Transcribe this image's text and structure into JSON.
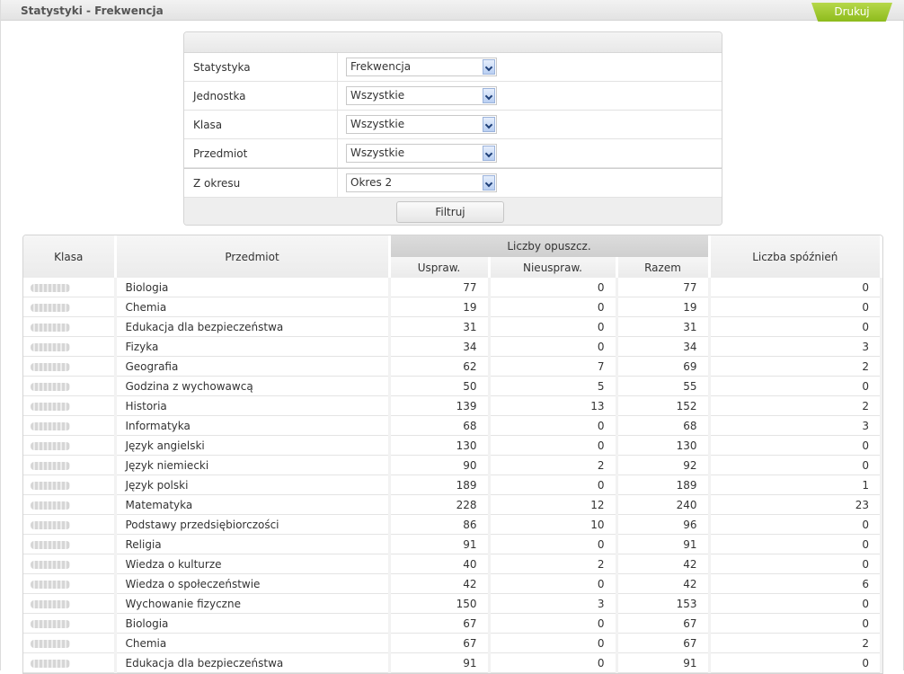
{
  "header": {
    "title": "Statystyki - Frekwencja",
    "print_label": "Drukuj"
  },
  "filter": {
    "rows": [
      {
        "label": "Statystyka",
        "value": "Frekwencja"
      },
      {
        "label": "Jednostka",
        "value": "Wszystkie"
      },
      {
        "label": "Klasa",
        "value": "Wszystkie"
      },
      {
        "label": "Przedmiot",
        "value": "Wszystkie"
      }
    ],
    "period": {
      "label": "Z okresu",
      "value": "Okres 2"
    },
    "submit_label": "Filtruj"
  },
  "table": {
    "headers": {
      "klasa": "Klasa",
      "przedmiot": "Przedmiot",
      "group": "Liczby opuszcz.",
      "uspraw": "Uspraw.",
      "nieuspraw": "Nieuspraw.",
      "razem": "Razem",
      "spoznienia": "Liczba spóźnień"
    },
    "rows": [
      {
        "przedmiot": "Biologia",
        "uspraw": "77",
        "nieuspraw": "0",
        "razem": "77",
        "spoznienia": "0"
      },
      {
        "przedmiot": "Chemia",
        "uspraw": "19",
        "nieuspraw": "0",
        "razem": "19",
        "spoznienia": "0"
      },
      {
        "przedmiot": "Edukacja dla bezpieczeństwa",
        "uspraw": "31",
        "nieuspraw": "0",
        "razem": "31",
        "spoznienia": "0"
      },
      {
        "przedmiot": "Fizyka",
        "uspraw": "34",
        "nieuspraw": "0",
        "razem": "34",
        "spoznienia": "3"
      },
      {
        "przedmiot": "Geografia",
        "uspraw": "62",
        "nieuspraw": "7",
        "razem": "69",
        "spoznienia": "2"
      },
      {
        "przedmiot": "Godzina z wychowawcą",
        "uspraw": "50",
        "nieuspraw": "5",
        "razem": "55",
        "spoznienia": "0"
      },
      {
        "przedmiot": "Historia",
        "uspraw": "139",
        "nieuspraw": "13",
        "razem": "152",
        "spoznienia": "2"
      },
      {
        "przedmiot": "Informatyka",
        "uspraw": "68",
        "nieuspraw": "0",
        "razem": "68",
        "spoznienia": "3"
      },
      {
        "przedmiot": "Język angielski",
        "uspraw": "130",
        "nieuspraw": "0",
        "razem": "130",
        "spoznienia": "0"
      },
      {
        "przedmiot": "Język niemiecki",
        "uspraw": "90",
        "nieuspraw": "2",
        "razem": "92",
        "spoznienia": "0"
      },
      {
        "przedmiot": "Język polski",
        "uspraw": "189",
        "nieuspraw": "0",
        "razem": "189",
        "spoznienia": "1"
      },
      {
        "przedmiot": "Matematyka",
        "uspraw": "228",
        "nieuspraw": "12",
        "razem": "240",
        "spoznienia": "23"
      },
      {
        "przedmiot": "Podstawy przedsiębiorczości",
        "uspraw": "86",
        "nieuspraw": "10",
        "razem": "96",
        "spoznienia": "0"
      },
      {
        "przedmiot": "Religia",
        "uspraw": "91",
        "nieuspraw": "0",
        "razem": "91",
        "spoznienia": "0"
      },
      {
        "przedmiot": "Wiedza o kulturze",
        "uspraw": "40",
        "nieuspraw": "2",
        "razem": "42",
        "spoznienia": "0"
      },
      {
        "przedmiot": "Wiedza o społeczeństwie",
        "uspraw": "42",
        "nieuspraw": "0",
        "razem": "42",
        "spoznienia": "6"
      },
      {
        "przedmiot": "Wychowanie fizyczne",
        "uspraw": "150",
        "nieuspraw": "3",
        "razem": "153",
        "spoznienia": "0"
      },
      {
        "przedmiot": "Biologia",
        "uspraw": "67",
        "nieuspraw": "0",
        "razem": "67",
        "spoznienia": "0"
      },
      {
        "przedmiot": "Chemia",
        "uspraw": "67",
        "nieuspraw": "0",
        "razem": "67",
        "spoznienia": "2"
      },
      {
        "przedmiot": "Edukacja dla bezpieczeństwa",
        "uspraw": "91",
        "nieuspraw": "0",
        "razem": "91",
        "spoznienia": "0"
      }
    ]
  }
}
